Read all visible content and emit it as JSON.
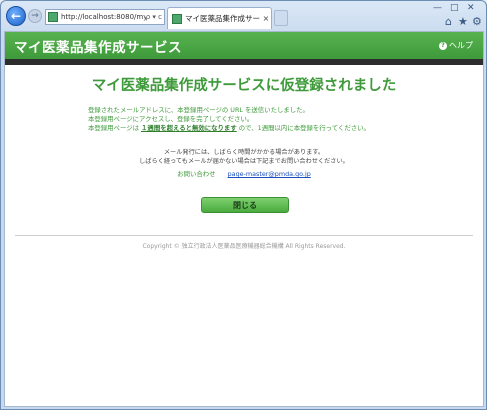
{
  "browser": {
    "address": "http://localhost:8080/mypa",
    "address_icons": "ρ ▾ c",
    "tab_title": "マイ医薬品集作成サービ...",
    "tab_close": "×",
    "window_controls": {
      "minimize": "—",
      "maximize": "□",
      "close": "✕"
    },
    "toolbar_icons": [
      "home-icon",
      "star-icon",
      "gear-icon"
    ]
  },
  "site": {
    "title": "マイ医薬品集作成サービス",
    "help_label": "ヘルプ",
    "help_icon_glyph": "?"
  },
  "content": {
    "headline": "マイ医薬品集作成サービスに仮登録されました",
    "message_line1": "登録されたメールアドレスに、本登録用ページの URL を送信いたしました。",
    "message_line2": "本登録用ページにアクセスし、登録を完了してください。",
    "message_line3_pre": "本登録用ページは",
    "message_line3_bold": "１週間を超えると無効になります",
    "message_line3_post": "ので、1週間以内に本登録を行ってください。",
    "note_line1": "メール発行には、しばらく時間がかかる場合があります。",
    "note_line2": "しばらく経ってもメールが届かない場合は下記までお問い合わせください。",
    "contact_label": "お問い合わせ",
    "contact_email": "page-master@pmda.go.jp",
    "close_button": "閉じる"
  },
  "footer": {
    "copyright": "Copyright © 独立行政法人医薬品医療機器総合機構 All Rights Reserved."
  },
  "colors": {
    "brand_green": "#3e9a3a",
    "header_dark": "#2d2d2d",
    "link_blue": "#1a4fc0"
  }
}
